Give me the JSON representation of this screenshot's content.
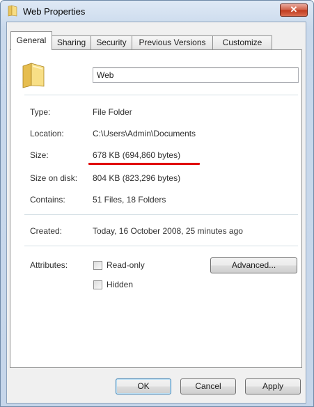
{
  "window": {
    "title": "Web Properties",
    "close_glyph": "✕"
  },
  "tabs": [
    {
      "label": "General"
    },
    {
      "label": "Sharing"
    },
    {
      "label": "Security"
    },
    {
      "label": "Previous Versions"
    },
    {
      "label": "Customize"
    }
  ],
  "general": {
    "name": "Web",
    "type_label": "Type:",
    "type_value": "File Folder",
    "location_label": "Location:",
    "location_value": "C:\\Users\\Admin\\Documents",
    "size_label": "Size:",
    "size_value": "678 KB (694,860 bytes)",
    "size_on_disk_label": "Size on disk:",
    "size_on_disk_value": "804 KB (823,296 bytes)",
    "contains_label": "Contains:",
    "contains_value": "51 Files, 18 Folders",
    "created_label": "Created:",
    "created_value": "Today, 16 October 2008, 25 minutes ago",
    "attributes_label": "Attributes:",
    "readonly_label": "Read-only",
    "hidden_label": "Hidden",
    "advanced_label": "Advanced..."
  },
  "footer": {
    "ok_label": "OK",
    "cancel_label": "Cancel",
    "apply_label": "Apply"
  },
  "colors": {
    "highlight_underline": "#e00000",
    "title_bar": "#c9d9ec",
    "close_button": "#c0391d"
  },
  "icons": {
    "title": "folder-icon",
    "main": "folder-icon"
  }
}
